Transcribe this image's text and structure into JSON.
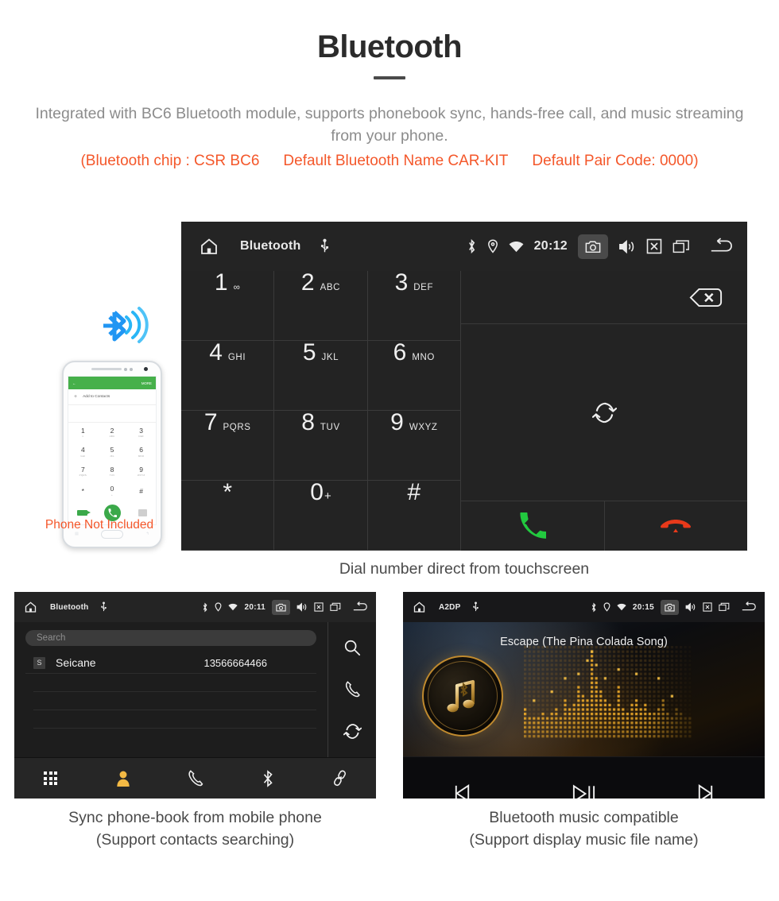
{
  "header": {
    "title": "Bluetooth",
    "description": "Integrated with BC6 Bluetooth module, supports phonebook sync, hands-free call, and music streaming from your phone.",
    "spec_chip": "(Bluetooth chip : CSR BC6",
    "spec_name": "Default Bluetooth Name CAR-KIT",
    "spec_pair": "Default Pair Code: 0000)",
    "accent_color": "#f4572a",
    "body_color": "#8c8c8c"
  },
  "phone_illustration": {
    "caption": "Phone Not Included",
    "app_back_icon": "back-arrow-icon",
    "app_more_label": "MORE",
    "add_contacts_label": "Add to Contacts",
    "bluetooth_icon": "bluetooth-wireless-icon",
    "keys": [
      {
        "digit": "1",
        "sub": "∞"
      },
      {
        "digit": "2",
        "sub": "ABC"
      },
      {
        "digit": "3",
        "sub": "DEF"
      },
      {
        "digit": "4",
        "sub": "GHI"
      },
      {
        "digit": "5",
        "sub": "JKL"
      },
      {
        "digit": "6",
        "sub": "MNO"
      },
      {
        "digit": "7",
        "sub": "PQRS"
      },
      {
        "digit": "8",
        "sub": "TUV"
      },
      {
        "digit": "9",
        "sub": "WXYZ"
      },
      {
        "digit": "*",
        "sub": ""
      },
      {
        "digit": "0",
        "sub": "+"
      },
      {
        "digit": "#",
        "sub": ""
      }
    ]
  },
  "dialer_screen": {
    "statusbar": {
      "home_icon": "home-icon",
      "title": "Bluetooth",
      "usb_icon": "usb-icon",
      "bluetooth_icon": "bluetooth-icon",
      "location_icon": "location-pin-icon",
      "wifi_icon": "wifi-icon",
      "time": "20:12",
      "camera_icon": "camera-icon",
      "volume_icon": "volume-icon",
      "close_icon": "close-box-icon",
      "windows_icon": "recent-apps-icon",
      "back_icon": "back-arrow-icon"
    },
    "keys": [
      {
        "digit": "1",
        "sub": "∞"
      },
      {
        "digit": "2",
        "sub": "ABC"
      },
      {
        "digit": "3",
        "sub": "DEF"
      },
      {
        "digit": "4",
        "sub": "GHI"
      },
      {
        "digit": "5",
        "sub": "JKL"
      },
      {
        "digit": "6",
        "sub": "MNO"
      },
      {
        "digit": "7",
        "sub": "PQRS"
      },
      {
        "digit": "8",
        "sub": "TUV"
      },
      {
        "digit": "9",
        "sub": "WXYZ"
      },
      {
        "digit": "*",
        "sub": ""
      },
      {
        "digit": "0",
        "sub": "+"
      },
      {
        "digit": "#",
        "sub": ""
      }
    ],
    "backspace_icon": "backspace-icon",
    "sync_icon": "sync-icon",
    "call_icon": "call-answer-icon",
    "hangup_icon": "call-hangup-icon",
    "call_color": "#22c93f",
    "hangup_color": "#e8391a",
    "navbar": [
      {
        "icon": "dialpad-icon",
        "active": true
      },
      {
        "icon": "contacts-person-icon",
        "active": false
      },
      {
        "icon": "call-history-icon",
        "active": false
      },
      {
        "icon": "bluetooth-icon",
        "active": false
      },
      {
        "icon": "link-pair-icon",
        "active": false
      }
    ],
    "active_color": "#f3b944",
    "caption": "Dial number direct from touchscreen"
  },
  "phonebook_screen": {
    "statusbar": {
      "home_icon": "home-icon",
      "title": "Bluetooth",
      "usb_icon": "usb-icon",
      "time": "20:11",
      "camera_icon": "camera-icon",
      "volume_icon": "volume-icon",
      "close_icon": "close-box-icon",
      "windows_icon": "recent-apps-icon",
      "back_icon": "back-arrow-icon"
    },
    "search_placeholder": "Search",
    "contacts": [
      {
        "initial": "S",
        "name": "Seicane",
        "number": "13566664466"
      }
    ],
    "side_actions": [
      {
        "icon": "search-icon"
      },
      {
        "icon": "call-history-icon"
      },
      {
        "icon": "sync-icon"
      }
    ],
    "navbar": [
      {
        "icon": "dialpad-icon",
        "active": false
      },
      {
        "icon": "contacts-person-icon",
        "active": true
      },
      {
        "icon": "call-history-icon",
        "active": false
      },
      {
        "icon": "bluetooth-icon",
        "active": false
      },
      {
        "icon": "link-pair-icon",
        "active": false
      }
    ],
    "caption_line1": "Sync phone-book from mobile phone",
    "caption_line2": "(Support contacts searching)"
  },
  "music_screen": {
    "statusbar": {
      "home_icon": "home-icon",
      "title": "A2DP",
      "usb_icon": "usb-icon",
      "time": "20:15",
      "camera_icon": "camera-icon",
      "volume_icon": "volume-icon",
      "close_icon": "close-box-icon",
      "windows_icon": "recent-apps-icon",
      "back_icon": "back-arrow-icon"
    },
    "song_title": "Escape (The Pina Colada Song)",
    "album_icon": "music-note-bluetooth-icon",
    "equalizer_icon": "dot-matrix-equalizer",
    "controls": [
      {
        "icon": "previous-track-icon"
      },
      {
        "icon": "play-pause-icon"
      },
      {
        "icon": "next-track-icon"
      }
    ],
    "accent_color": "#c08a2e",
    "caption_line1": "Bluetooth music compatible",
    "caption_line2": "(Support display music file name)"
  }
}
